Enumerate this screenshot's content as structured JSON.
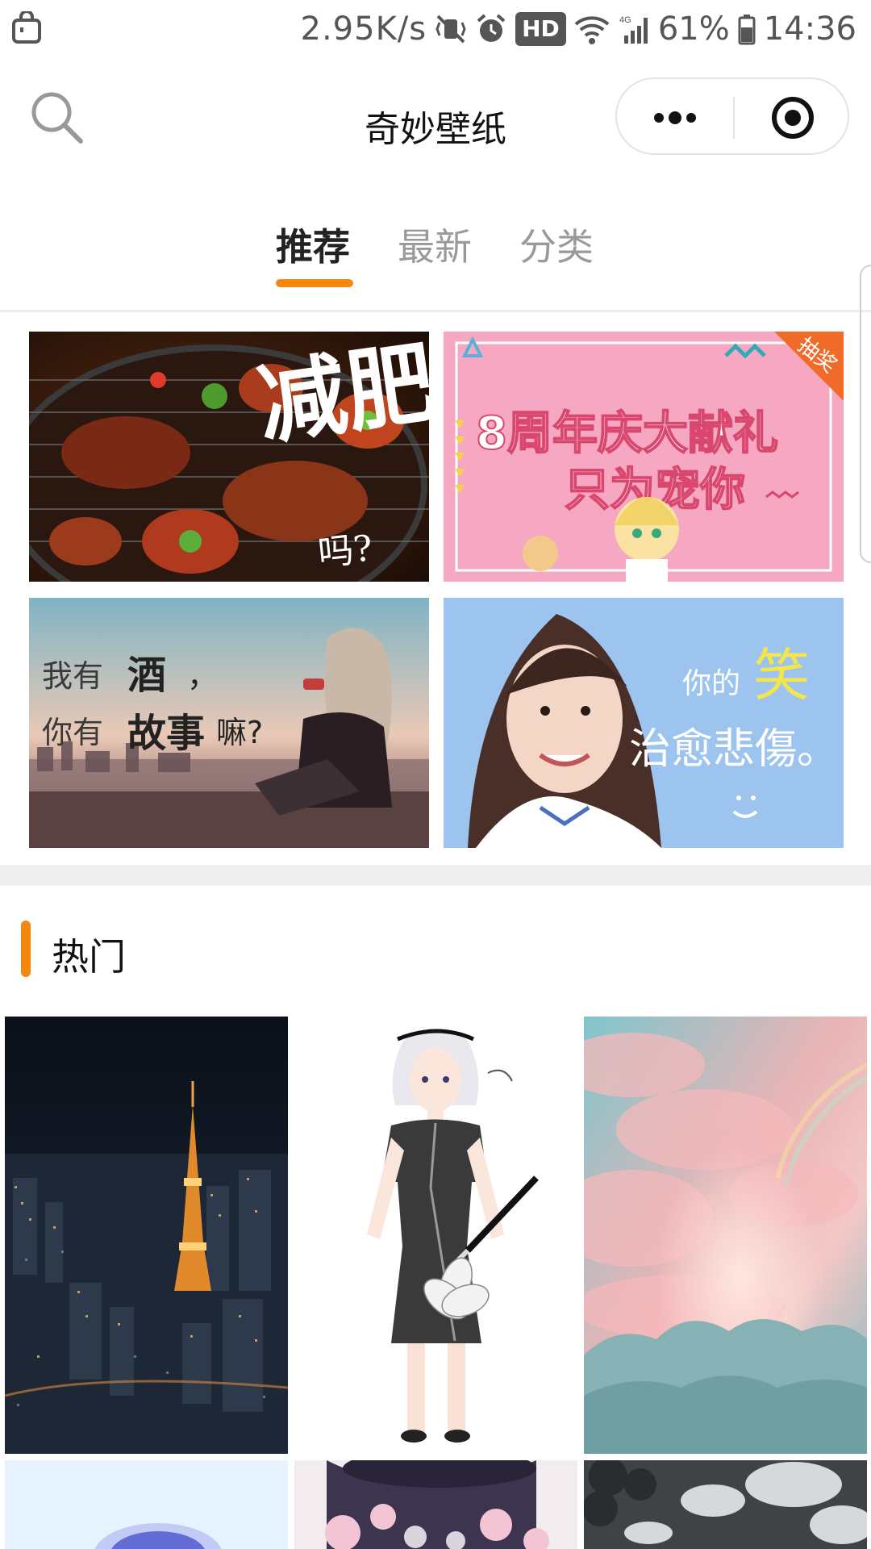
{
  "status_bar": {
    "speed": "2.95K/s",
    "hd": "HD",
    "network": "4G",
    "battery": "61%",
    "time": "14:36"
  },
  "nav": {
    "title": "奇妙壁纸"
  },
  "tabs": [
    {
      "label": "推荐",
      "active": true
    },
    {
      "label": "最新",
      "active": false
    },
    {
      "label": "分类",
      "active": false
    }
  ],
  "banners": [
    {
      "text_main": "减肥",
      "text_sub": "吗?"
    },
    {
      "badge": "抽奖",
      "line1": "8周年庆大献礼",
      "line2": "只为宠你"
    },
    {
      "line1_a": "我有",
      "line1_b": "酒",
      "line1_c": "，",
      "line2_a": "你有",
      "line2_b": "故事",
      "line2_c": "嘛?"
    },
    {
      "line1_a": "你的",
      "line1_b": "笑",
      "line2": "治愈悲傷。"
    }
  ],
  "hot": {
    "title": "热门"
  },
  "colors": {
    "accent": "#f5870f",
    "tab_inactive": "#999999",
    "divider": "#eeeeee"
  }
}
